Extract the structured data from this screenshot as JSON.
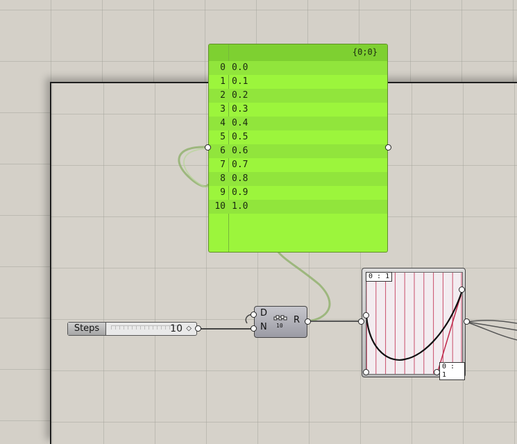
{
  "panel": {
    "path": "{0;0}",
    "rows": [
      {
        "index": "0",
        "value": "0.0"
      },
      {
        "index": "1",
        "value": "0.1"
      },
      {
        "index": "2",
        "value": "0.2"
      },
      {
        "index": "3",
        "value": "0.3"
      },
      {
        "index": "4",
        "value": "0.4"
      },
      {
        "index": "5",
        "value": "0.5"
      },
      {
        "index": "6",
        "value": "0.6"
      },
      {
        "index": "7",
        "value": "0.7"
      },
      {
        "index": "8",
        "value": "0.8"
      },
      {
        "index": "9",
        "value": "0.9"
      },
      {
        "index": "10",
        "value": "1.0"
      }
    ]
  },
  "slider": {
    "label": "Steps",
    "value": "10",
    "diamond": "◇"
  },
  "range": {
    "input_d": "D",
    "input_n": "N",
    "output_r": "R",
    "icon_text": "10"
  },
  "graph_mapper": {
    "domain_top": "0 : 1",
    "domain_bottom": "0 : 1"
  },
  "colors": {
    "panel_green": "#9cf53c",
    "panel_header": "#7ed031",
    "graph_grid": "#c0284a",
    "wire": "#8fb06a"
  }
}
